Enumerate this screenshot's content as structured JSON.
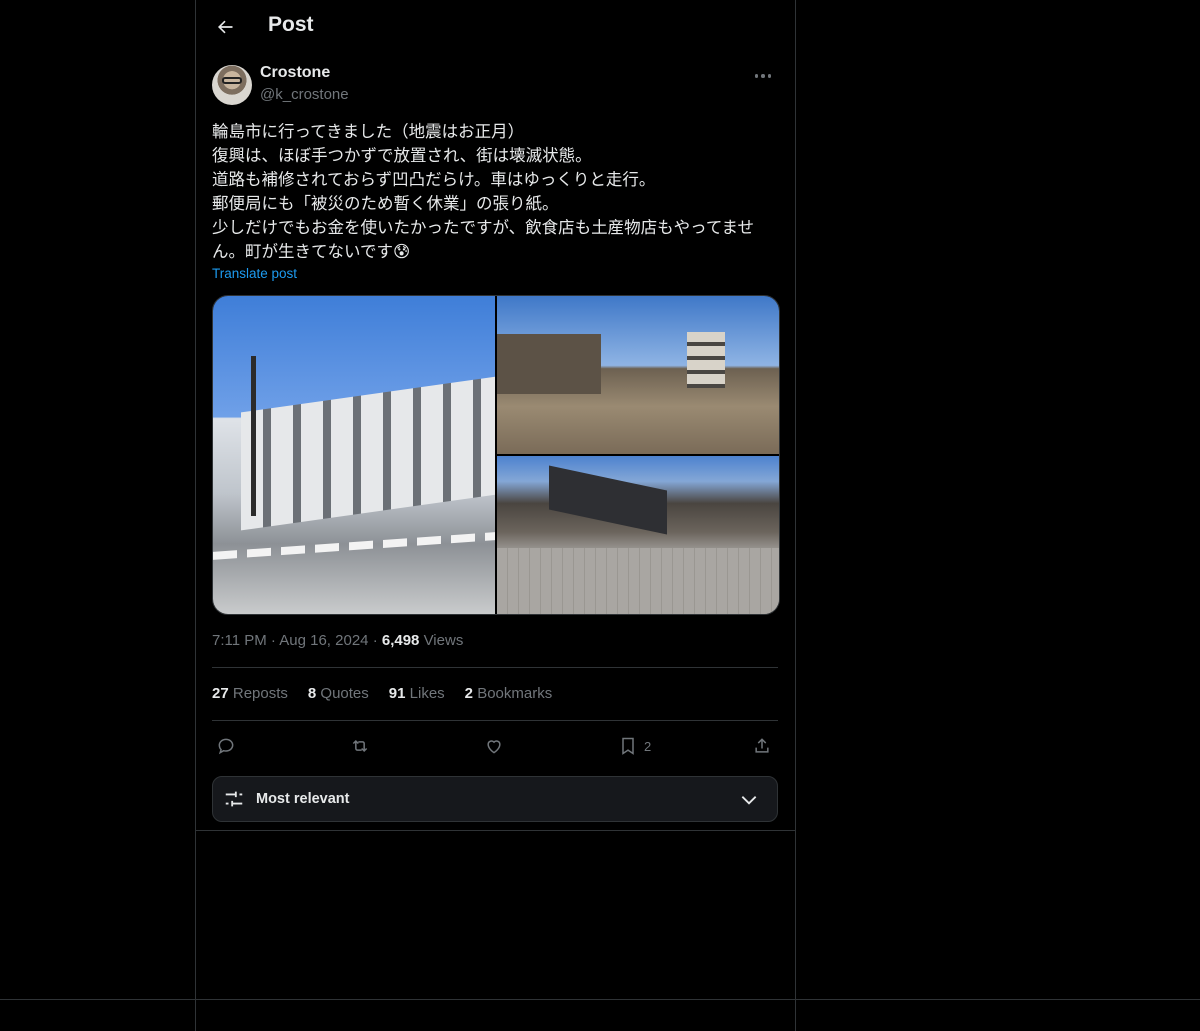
{
  "header": {
    "title": "Post"
  },
  "author": {
    "display_name": "Crostone",
    "handle": "@k_crostone"
  },
  "post": {
    "text": "輪島市に行ってきました（地震はお正月）\n復興は、ほぼ手つかずで放置され、街は壊滅状態。\n道路も補修されておらず凹凸だらけ。車はゆっくりと走行。\n郵便局にも「被災のため暫く休業」の張り紙。\n少しだけでもお金を使いたかったですが、飲食店も土産物店もやってません。町が生きてないです😰",
    "translate_label": "Translate post",
    "time": "7:11 PM",
    "date": "Aug 16, 2024",
    "views_count": "6,498",
    "views_label": "Views"
  },
  "stats": [
    {
      "count": "27",
      "label": "Reposts"
    },
    {
      "count": "8",
      "label": "Quotes"
    },
    {
      "count": "91",
      "label": "Likes"
    },
    {
      "count": "2",
      "label": "Bookmarks"
    }
  ],
  "actions": {
    "bookmark_count": "2"
  },
  "sort": {
    "label": "Most relevant"
  },
  "icons": [
    "back-arrow-icon",
    "more-icon",
    "reply-icon",
    "repost-icon",
    "like-icon",
    "bookmark-icon",
    "share-icon",
    "sliders-icon",
    "chevron-down-icon"
  ],
  "colors": {
    "accent": "#1d9bf0",
    "text": "#e7e9ea",
    "muted": "#71767b",
    "border": "#2f3336"
  }
}
